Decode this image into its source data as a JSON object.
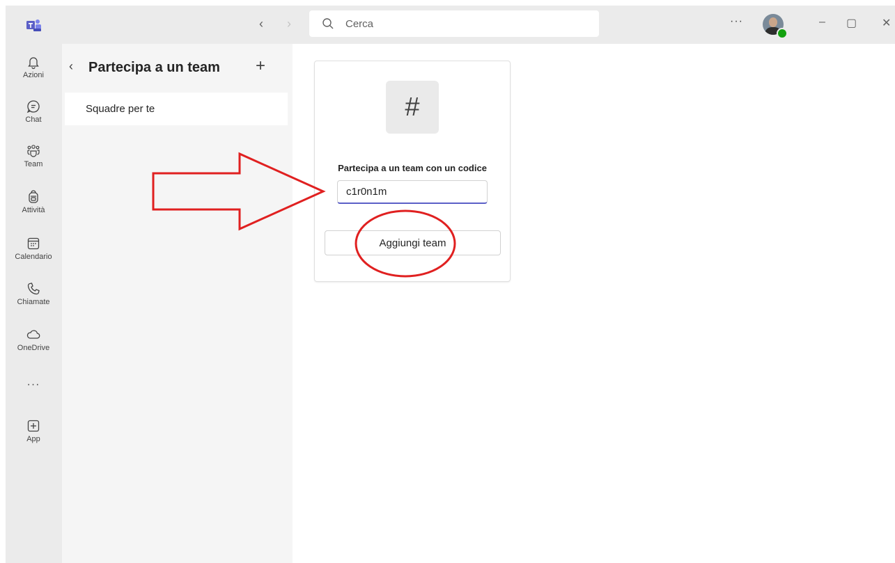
{
  "titlebar": {
    "search_placeholder": "Cerca",
    "more_label": "···"
  },
  "rail": {
    "items": [
      {
        "label": "Azioni",
        "icon": "bell-icon"
      },
      {
        "label": "Chat",
        "icon": "chat-icon"
      },
      {
        "label": "Team",
        "icon": "team-icon"
      },
      {
        "label": "Attività",
        "icon": "backpack-icon"
      },
      {
        "label": "Calendario",
        "icon": "calendar-icon"
      },
      {
        "label": "Chiamate",
        "icon": "phone-icon"
      },
      {
        "label": "OneDrive",
        "icon": "cloud-icon"
      },
      {
        "label": "App",
        "icon": "plus-box-icon"
      }
    ],
    "more_label": "···"
  },
  "panel": {
    "title": "Partecipa a un team",
    "items": [
      {
        "label": "Squadre per te"
      }
    ]
  },
  "join_card": {
    "heading": "Partecipa a un team con un codice",
    "code_value": "c1r0n1m",
    "button_label": "Aggiungi team"
  },
  "colors": {
    "accent": "#5b5fc7",
    "annotation_red": "#e02020",
    "presence_green": "#13a10e"
  }
}
